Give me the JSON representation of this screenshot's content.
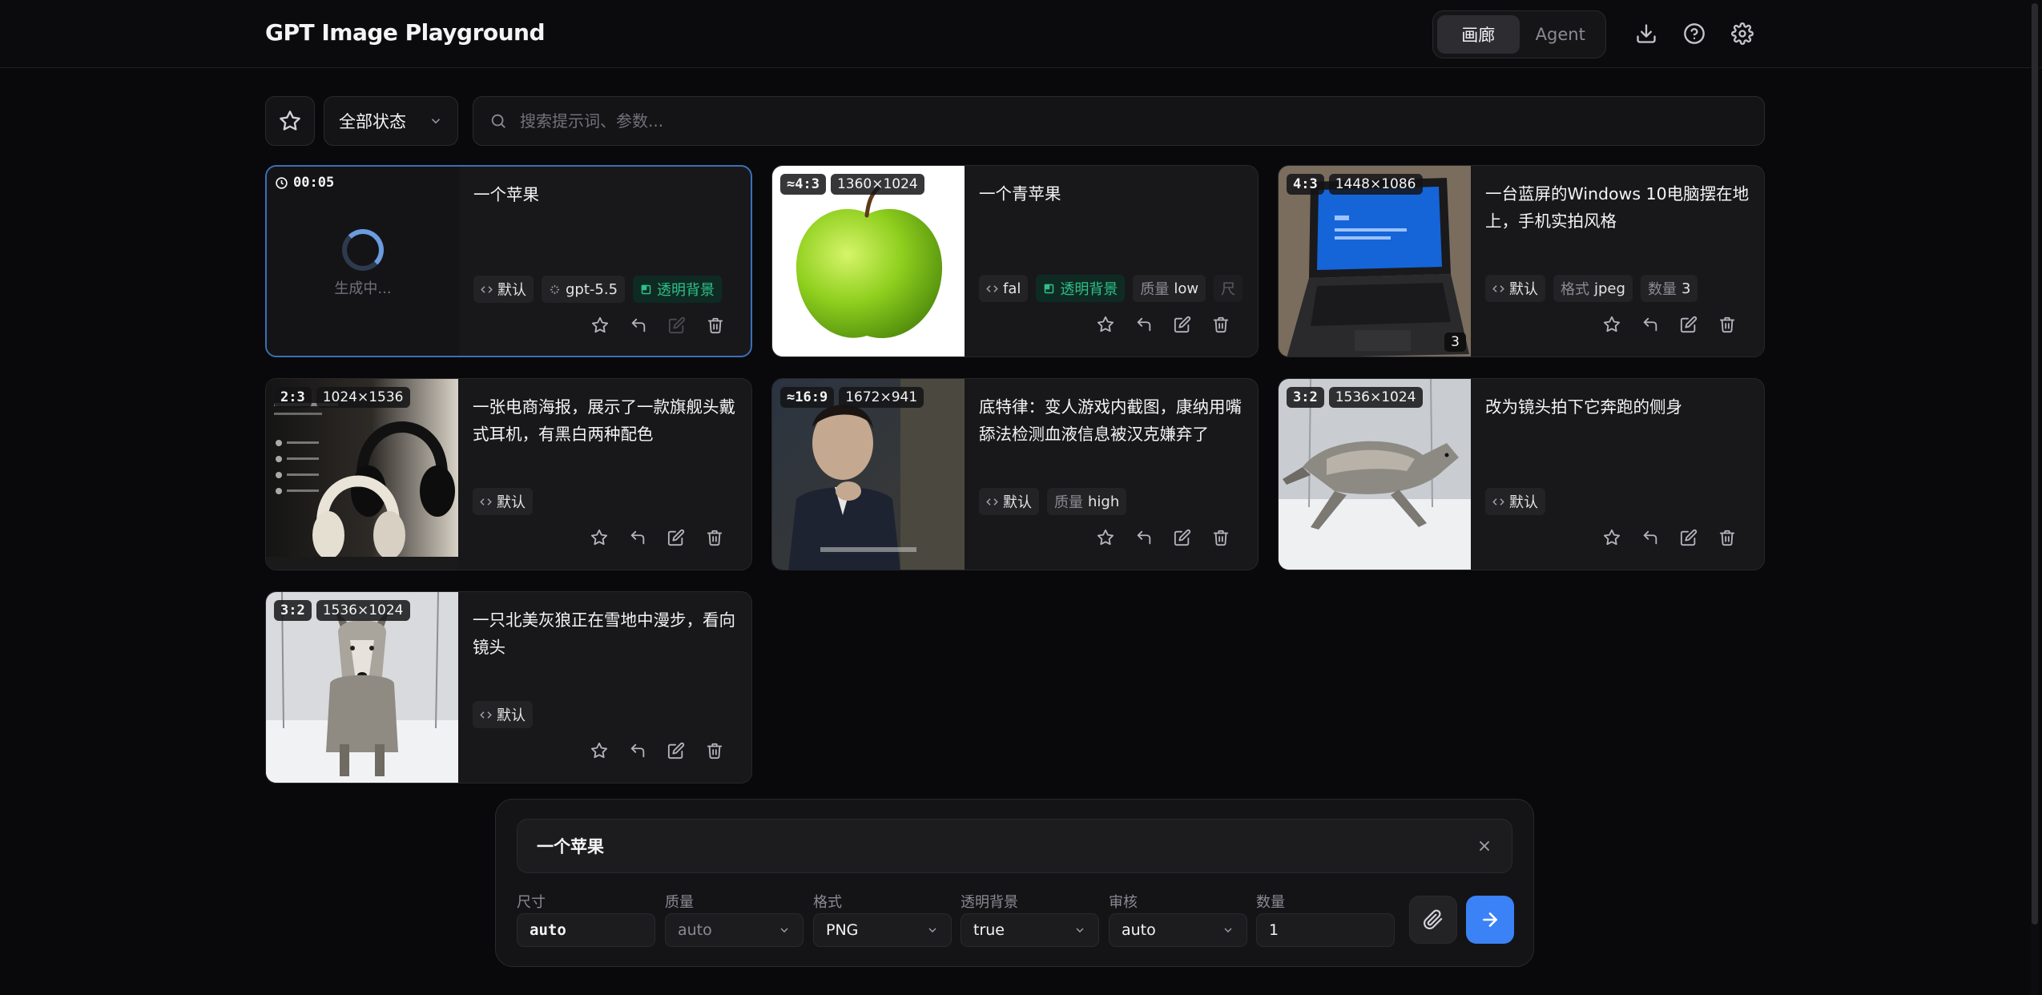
{
  "header": {
    "title": "GPT Image Playground",
    "modes": [
      "画廊",
      "Agent"
    ],
    "active_mode": "画廊"
  },
  "filters": {
    "status_value": "全部状态",
    "search_placeholder": "搜索提示词、参数..."
  },
  "cards": [
    {
      "state": "generating",
      "timer": "00:05",
      "status_text": "生成中...",
      "prompt": "一个苹果",
      "tags": [
        {
          "icon": "code-icon",
          "label": "默认"
        },
        {
          "icon": "sparkle-icon",
          "label": "gpt-5.5"
        },
        {
          "icon": "transparent-icon",
          "label": "透明背景",
          "green": true
        }
      ]
    },
    {
      "ratio": "≈4:3",
      "size": "1360×1024",
      "prompt": "一个青苹果",
      "tags": [
        {
          "icon": "code-icon",
          "label": "fal"
        },
        {
          "icon": "transparent-icon",
          "label": "透明背景",
          "green": true
        },
        {
          "key": "质量",
          "label": "low"
        },
        {
          "key": "尺",
          "label": ""
        }
      ]
    },
    {
      "ratio": "4:3",
      "size": "1448×1086",
      "count": "3",
      "prompt": "一台蓝屏的Windows 10电脑摆在地上，手机实拍风格",
      "tags": [
        {
          "icon": "code-icon",
          "label": "默认"
        },
        {
          "key": "格式",
          "label": "jpeg"
        },
        {
          "key": "数量",
          "label": "3"
        }
      ]
    },
    {
      "ratio": "2:3",
      "size": "1024×1536",
      "prompt": "一张电商海报，展示了一款旗舰头戴式耳机，有黑白两种配色",
      "tags": [
        {
          "icon": "code-icon",
          "label": "默认"
        }
      ]
    },
    {
      "ratio": "≈16:9",
      "size": "1672×941",
      "prompt": "底特律：变人游戏内截图，康纳用嘴舔法检测血液信息被汉克嫌弃了",
      "tags": [
        {
          "icon": "code-icon",
          "label": "默认"
        },
        {
          "key": "质量",
          "label": "high"
        }
      ]
    },
    {
      "ratio": "3:2",
      "size": "1536×1024",
      "prompt": "改为镜头拍下它奔跑的侧身",
      "tags": [
        {
          "icon": "code-icon",
          "label": "默认"
        }
      ]
    },
    {
      "ratio": "3:2",
      "size": "1536×1024",
      "prompt": "一只北美灰狼正在雪地中漫步，看向镜头",
      "tags": [
        {
          "icon": "code-icon",
          "label": "默认"
        }
      ]
    }
  ],
  "composer": {
    "prompt": "一个苹果",
    "params": [
      {
        "label": "尺寸",
        "value": "auto"
      },
      {
        "label": "质量",
        "value": "auto"
      },
      {
        "label": "格式",
        "value": "PNG"
      },
      {
        "label": "透明背景",
        "value": "true"
      },
      {
        "label": "审核",
        "value": "auto"
      },
      {
        "label": "数量",
        "value": "1"
      }
    ]
  },
  "colors": {
    "accent": "#3b82f6",
    "green_tag": "#2fc08a",
    "active_border": "#3b6fb8"
  }
}
